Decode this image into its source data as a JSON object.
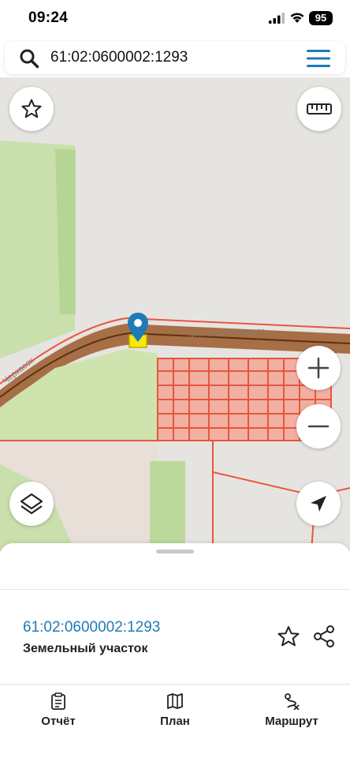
{
  "status_bar": {
    "time": "09:24",
    "battery": "95",
    "icons": [
      "signal-icon",
      "wifi-icon",
      "battery-icon"
    ]
  },
  "search": {
    "value": "61:02:0600002:1293",
    "icons": [
      "search-icon",
      "menu-icon"
    ]
  },
  "map": {
    "buttons": [
      "favorite-star-icon",
      "ruler-icon",
      "zoom-in-icon",
      "zoom-out-icon",
      "layers-icon",
      "locate-arrow-icon"
    ],
    "street_label_main": "М4 - Новочеркасск",
    "street_label_left": "Черкасск",
    "colors": {
      "background": "#e6e4e1",
      "green_area": "#b9d99a",
      "road": "#8b4a1f",
      "parcel_outline": "#e8553e",
      "parcel_fill": "#f2a596",
      "selected_parcel": "#f5e90a",
      "pin": "#1e7bb8"
    }
  },
  "sheet": {
    "parcel_number": "61:02:0600002:1293",
    "parcel_type": "Земельный участок",
    "icons": [
      "star-icon",
      "share-icon"
    ]
  },
  "tabbar": {
    "tabs": [
      {
        "label": "Отчёт",
        "icon": "report-clipboard-icon"
      },
      {
        "label": "План",
        "icon": "map-plan-icon"
      },
      {
        "label": "Маршрут",
        "icon": "route-icon"
      }
    ]
  }
}
